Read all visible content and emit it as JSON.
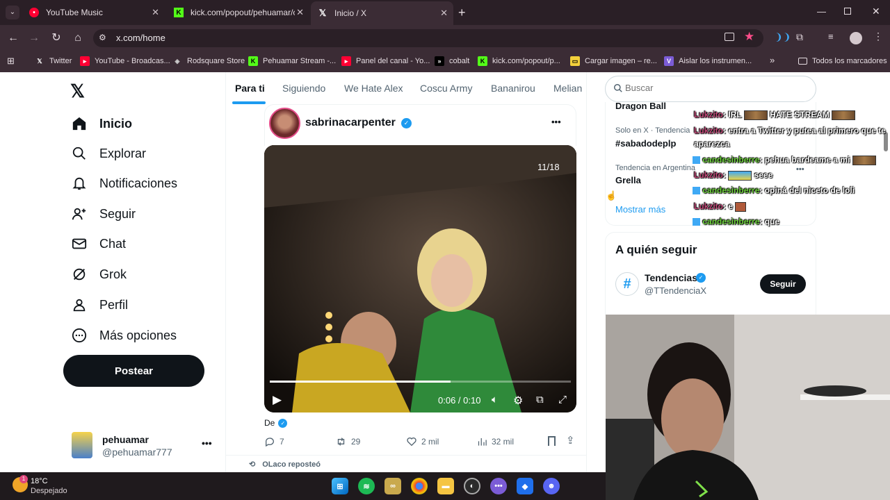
{
  "browser": {
    "tabs": [
      {
        "label": "YouTube Music"
      },
      {
        "label": "kick.com/popout/pehuamar/chat"
      },
      {
        "label": "Inicio / X"
      }
    ],
    "url": "x.com/home",
    "bookmarks": [
      {
        "label": "Twitter"
      },
      {
        "label": "YouTube - Broadcas..."
      },
      {
        "label": "Rodsquare Store"
      },
      {
        "label": "Pehuamar Stream -..."
      },
      {
        "label": "Panel del canal - Yo..."
      },
      {
        "label": "cobalt"
      },
      {
        "label": "kick.com/popout/p..."
      },
      {
        "label": "Cargar imagen – re..."
      },
      {
        "label": "Aislar los instrumen..."
      }
    ],
    "all_bookmarks": "Todos los marcadores"
  },
  "nav": {
    "items": [
      {
        "label": "Inicio",
        "icon": "home-icon"
      },
      {
        "label": "Explorar",
        "icon": "search-icon"
      },
      {
        "label": "Notificaciones",
        "icon": "bell-icon"
      },
      {
        "label": "Seguir",
        "icon": "person-plus-icon"
      },
      {
        "label": "Chat",
        "icon": "mail-icon"
      },
      {
        "label": "Grok",
        "icon": "grok-icon"
      },
      {
        "label": "Perfil",
        "icon": "person-icon"
      },
      {
        "label": "Más opciones",
        "icon": "more-circle-icon"
      }
    ],
    "post_label": "Postear",
    "account": {
      "name": "pehuamar",
      "handle": "@pehuamar777"
    }
  },
  "feed": {
    "tabs": [
      "Para ti",
      "Siguiendo",
      "We Hate Alex",
      "Coscu Army",
      "Bananirou",
      "Melian"
    ],
    "post": {
      "author": "sabrinacarpenter",
      "counter": "11/18",
      "time": "0:06 / 0:10",
      "progress": 0.6,
      "caption": "De",
      "replies": "7",
      "reposts": "29",
      "likes": "2 mil",
      "views": "32 mil"
    },
    "repost_note": "OLaco reposteó"
  },
  "sidebar": {
    "search_placeholder": "Buscar",
    "trend_top": "Dragon Ball",
    "trends": [
      {
        "sub": "Solo en X · Tendencia",
        "main": "#sabadodeplp"
      },
      {
        "sub": "Tendencia en Argentina",
        "main": "Grella"
      }
    ],
    "show_more": "Mostrar más",
    "who_to_follow": "A quién seguir",
    "suggest": {
      "name": "Tendencias",
      "handle": "@TTendenciaX",
      "button": "Seguir"
    }
  },
  "chat": [
    {
      "user": "Lukzito",
      "msg": ": IRL",
      "after": "HATE STREAM"
    },
    {
      "user": "Lukzito",
      "msg": ": entra a Twitter y putea al primero que te",
      "cont": "aparezca"
    },
    {
      "user": "candesinberre",
      "msg": ": pehua bardeame a mi"
    },
    {
      "user": "Lukzito",
      "msg": ":",
      "after": "seee"
    },
    {
      "user": "candesinberre",
      "msg": ": opiná del niceto de loli"
    },
    {
      "user": "Lukzito",
      "msg": ": e"
    },
    {
      "user": "candesinberre",
      "msg": ": que"
    }
  ],
  "taskbar": {
    "temp": "18°C",
    "weather": "Despejado",
    "badge": "1"
  }
}
